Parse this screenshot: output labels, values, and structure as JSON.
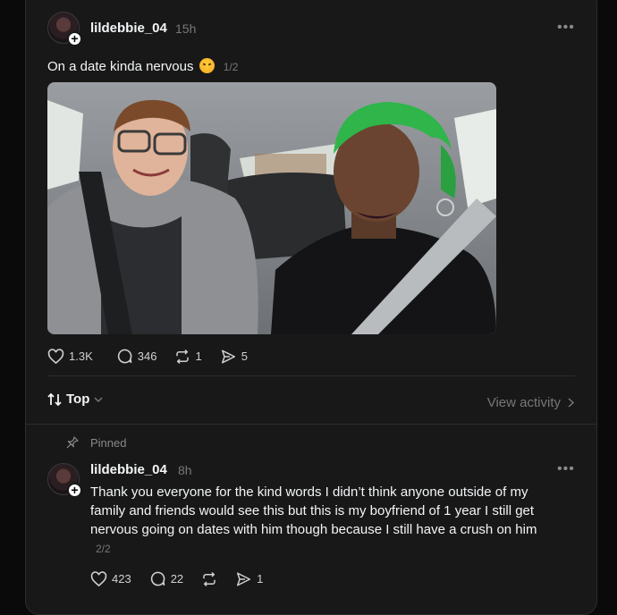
{
  "post": {
    "username": "lildebbie_04",
    "time": "15h",
    "text": "On a date kinda nervous",
    "page": "1/2",
    "likes": "1.3K",
    "comments": "346",
    "reposts": "1",
    "shares": "5"
  },
  "sort": {
    "label": "Top"
  },
  "view_activity": "View activity",
  "reply": {
    "pinned_label": "Pinned",
    "username": "lildebbie_04",
    "time": "8h",
    "text": "Thank you everyone for the kind words I didn’t think anyone outside of my family and friends would see this but this is my boyfriend of 1 year I still get nervous going on dates with him though because I still have a crush on him",
    "page": "2/2",
    "likes": "423",
    "comments": "22",
    "shares": "1"
  },
  "colors": {
    "background": "#181818",
    "text": "#f3f5f7",
    "muted": "#777777",
    "hair_accent": "#2fb54a"
  }
}
